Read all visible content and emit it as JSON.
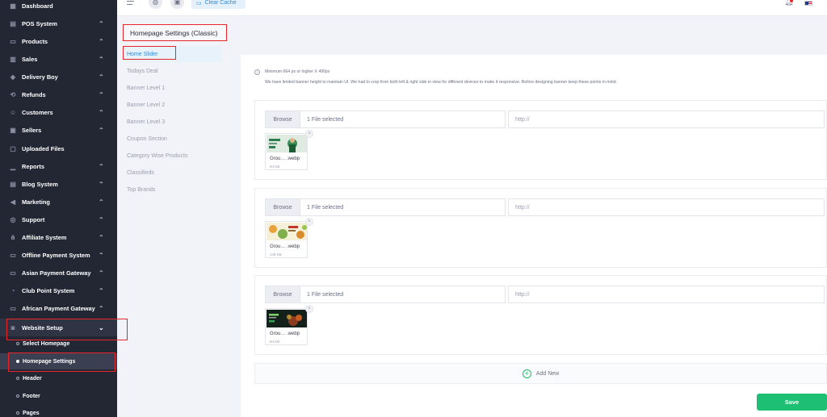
{
  "sidebar": {
    "items": [
      {
        "label": "Dashboard",
        "icon": "dashboard-icon"
      },
      {
        "label": "POS System",
        "icon": "pos-icon"
      },
      {
        "label": "Products",
        "icon": "products-icon"
      },
      {
        "label": "Sales",
        "icon": "sales-icon"
      },
      {
        "label": "Delivery Boy",
        "icon": "delivery-icon"
      },
      {
        "label": "Refunds",
        "icon": "refund-icon"
      },
      {
        "label": "Customers",
        "icon": "customers-icon"
      },
      {
        "label": "Sellers",
        "icon": "sellers-icon"
      },
      {
        "label": "Uploaded Files",
        "icon": "upload-icon"
      },
      {
        "label": "Reports",
        "icon": "reports-icon"
      },
      {
        "label": "Blog System",
        "icon": "blog-icon"
      },
      {
        "label": "Marketing",
        "icon": "marketing-icon"
      },
      {
        "label": "Support",
        "icon": "support-icon"
      },
      {
        "label": "Affiliate System",
        "icon": "affiliate-icon"
      },
      {
        "label": "Offline Payment System",
        "icon": "offline-payment-icon"
      },
      {
        "label": "Asian Payment Gateway",
        "icon": "asian-payment-icon"
      },
      {
        "label": "Club Point System",
        "icon": "club-point-icon"
      },
      {
        "label": "African Payment Gateway",
        "icon": "african-payment-icon"
      },
      {
        "label": "Website Setup",
        "icon": "website-setup-icon"
      }
    ],
    "subitems": [
      {
        "label": "Select Homepage"
      },
      {
        "label": "Homepage Settings"
      },
      {
        "label": "Header"
      },
      {
        "label": "Footer"
      },
      {
        "label": "Pages"
      }
    ]
  },
  "topbar": {
    "clear_cache": "Clear Cache"
  },
  "page": {
    "title": "Homepage Settings (Classic)"
  },
  "tabs": [
    {
      "label": "Home Slider"
    },
    {
      "label": "Todays Deal"
    },
    {
      "label": "Banner Level 1"
    },
    {
      "label": "Banner Level 2"
    },
    {
      "label": "Banner Level 3"
    },
    {
      "label": "Coupon Section"
    },
    {
      "label": "Category Wise Products"
    },
    {
      "label": "Classifieds"
    },
    {
      "label": "Top Brands"
    }
  ],
  "info": {
    "line1": "Minimum 664 px or higher X 490px",
    "line2": "We have limited banner height to maintain UI. We had to crop from both left & right side in view for different devices to make it responsive. Before designing banner keep these points in mind."
  },
  "sliders": [
    {
      "browse": "Browse",
      "file_selected": "1 File selected",
      "url_placeholder": "http://",
      "file_name": "Grou… .webp",
      "file_size": "64 KB"
    },
    {
      "browse": "Browse",
      "file_selected": "1 File selected",
      "url_placeholder": "http://",
      "file_name": "Grou… .webp",
      "file_size": "145 KB"
    },
    {
      "browse": "Browse",
      "file_selected": "1 File selected",
      "url_placeholder": "http://",
      "file_name": "Grou… .webp",
      "file_size": "94 KB"
    }
  ],
  "add_new": "Add New",
  "save": "Save",
  "colors": {
    "sidebar_bg": "#232734",
    "accent_blue": "#2d8bd9",
    "save_green": "#1dbf73",
    "highlight_red": "#e8262a"
  }
}
